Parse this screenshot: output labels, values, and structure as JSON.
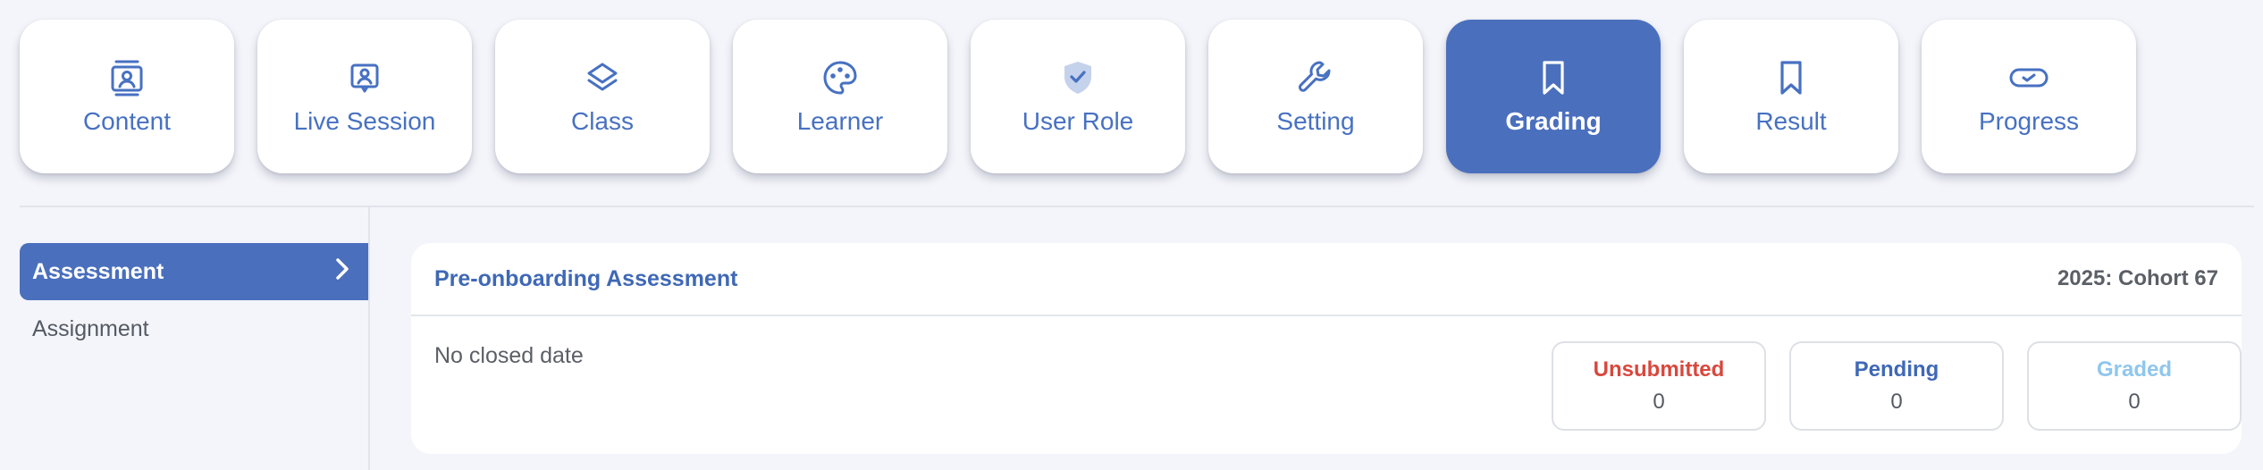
{
  "topnav": {
    "tabs": [
      {
        "label": "Content",
        "icon": "contact-card-icon",
        "active": false
      },
      {
        "label": "Live Session",
        "icon": "presenter-icon",
        "active": false
      },
      {
        "label": "Class",
        "icon": "layers-icon",
        "active": false
      },
      {
        "label": "Learner",
        "icon": "palette-face-icon",
        "active": false
      },
      {
        "label": "User Role",
        "icon": "shield-check-icon",
        "active": false
      },
      {
        "label": "Setting",
        "icon": "wrench-icon",
        "active": false
      },
      {
        "label": "Grading",
        "icon": "bookmark-icon",
        "active": true
      },
      {
        "label": "Result",
        "icon": "bookmark-icon",
        "active": false
      },
      {
        "label": "Progress",
        "icon": "toggle-check-icon",
        "active": false
      }
    ]
  },
  "sidebar": {
    "items": [
      {
        "label": "Assessment",
        "active": true
      },
      {
        "label": "Assignment",
        "active": false
      }
    ]
  },
  "card": {
    "title": "Pre-onboarding Assessment",
    "cohort": "2025: Cohort 67",
    "close_date": "No closed date",
    "stats": [
      {
        "label": "Unsubmitted",
        "value": "0",
        "color": "#d9473d"
      },
      {
        "label": "Pending",
        "value": "0",
        "color": "#3f68b6"
      },
      {
        "label": "Graded",
        "value": "0",
        "color": "#8fc6ec"
      }
    ]
  },
  "colors": {
    "accent": "#4a6fbd",
    "background": "#f4f5fa"
  }
}
